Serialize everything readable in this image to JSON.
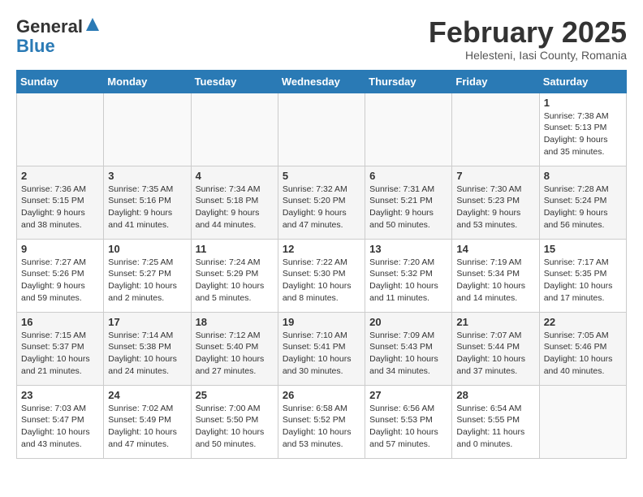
{
  "header": {
    "logo_general": "General",
    "logo_blue": "Blue",
    "title": "February 2025",
    "subtitle": "Helesteni, Iasi County, Romania"
  },
  "days_of_week": [
    "Sunday",
    "Monday",
    "Tuesday",
    "Wednesday",
    "Thursday",
    "Friday",
    "Saturday"
  ],
  "weeks": [
    [
      {
        "day": "",
        "info": ""
      },
      {
        "day": "",
        "info": ""
      },
      {
        "day": "",
        "info": ""
      },
      {
        "day": "",
        "info": ""
      },
      {
        "day": "",
        "info": ""
      },
      {
        "day": "",
        "info": ""
      },
      {
        "day": "1",
        "info": "Sunrise: 7:38 AM\nSunset: 5:13 PM\nDaylight: 9 hours and 35 minutes."
      }
    ],
    [
      {
        "day": "2",
        "info": "Sunrise: 7:36 AM\nSunset: 5:15 PM\nDaylight: 9 hours and 38 minutes."
      },
      {
        "day": "3",
        "info": "Sunrise: 7:35 AM\nSunset: 5:16 PM\nDaylight: 9 hours and 41 minutes."
      },
      {
        "day": "4",
        "info": "Sunrise: 7:34 AM\nSunset: 5:18 PM\nDaylight: 9 hours and 44 minutes."
      },
      {
        "day": "5",
        "info": "Sunrise: 7:32 AM\nSunset: 5:20 PM\nDaylight: 9 hours and 47 minutes."
      },
      {
        "day": "6",
        "info": "Sunrise: 7:31 AM\nSunset: 5:21 PM\nDaylight: 9 hours and 50 minutes."
      },
      {
        "day": "7",
        "info": "Sunrise: 7:30 AM\nSunset: 5:23 PM\nDaylight: 9 hours and 53 minutes."
      },
      {
        "day": "8",
        "info": "Sunrise: 7:28 AM\nSunset: 5:24 PM\nDaylight: 9 hours and 56 minutes."
      }
    ],
    [
      {
        "day": "9",
        "info": "Sunrise: 7:27 AM\nSunset: 5:26 PM\nDaylight: 9 hours and 59 minutes."
      },
      {
        "day": "10",
        "info": "Sunrise: 7:25 AM\nSunset: 5:27 PM\nDaylight: 10 hours and 2 minutes."
      },
      {
        "day": "11",
        "info": "Sunrise: 7:24 AM\nSunset: 5:29 PM\nDaylight: 10 hours and 5 minutes."
      },
      {
        "day": "12",
        "info": "Sunrise: 7:22 AM\nSunset: 5:30 PM\nDaylight: 10 hours and 8 minutes."
      },
      {
        "day": "13",
        "info": "Sunrise: 7:20 AM\nSunset: 5:32 PM\nDaylight: 10 hours and 11 minutes."
      },
      {
        "day": "14",
        "info": "Sunrise: 7:19 AM\nSunset: 5:34 PM\nDaylight: 10 hours and 14 minutes."
      },
      {
        "day": "15",
        "info": "Sunrise: 7:17 AM\nSunset: 5:35 PM\nDaylight: 10 hours and 17 minutes."
      }
    ],
    [
      {
        "day": "16",
        "info": "Sunrise: 7:15 AM\nSunset: 5:37 PM\nDaylight: 10 hours and 21 minutes."
      },
      {
        "day": "17",
        "info": "Sunrise: 7:14 AM\nSunset: 5:38 PM\nDaylight: 10 hours and 24 minutes."
      },
      {
        "day": "18",
        "info": "Sunrise: 7:12 AM\nSunset: 5:40 PM\nDaylight: 10 hours and 27 minutes."
      },
      {
        "day": "19",
        "info": "Sunrise: 7:10 AM\nSunset: 5:41 PM\nDaylight: 10 hours and 30 minutes."
      },
      {
        "day": "20",
        "info": "Sunrise: 7:09 AM\nSunset: 5:43 PM\nDaylight: 10 hours and 34 minutes."
      },
      {
        "day": "21",
        "info": "Sunrise: 7:07 AM\nSunset: 5:44 PM\nDaylight: 10 hours and 37 minutes."
      },
      {
        "day": "22",
        "info": "Sunrise: 7:05 AM\nSunset: 5:46 PM\nDaylight: 10 hours and 40 minutes."
      }
    ],
    [
      {
        "day": "23",
        "info": "Sunrise: 7:03 AM\nSunset: 5:47 PM\nDaylight: 10 hours and 43 minutes."
      },
      {
        "day": "24",
        "info": "Sunrise: 7:02 AM\nSunset: 5:49 PM\nDaylight: 10 hours and 47 minutes."
      },
      {
        "day": "25",
        "info": "Sunrise: 7:00 AM\nSunset: 5:50 PM\nDaylight: 10 hours and 50 minutes."
      },
      {
        "day": "26",
        "info": "Sunrise: 6:58 AM\nSunset: 5:52 PM\nDaylight: 10 hours and 53 minutes."
      },
      {
        "day": "27",
        "info": "Sunrise: 6:56 AM\nSunset: 5:53 PM\nDaylight: 10 hours and 57 minutes."
      },
      {
        "day": "28",
        "info": "Sunrise: 6:54 AM\nSunset: 5:55 PM\nDaylight: 11 hours and 0 minutes."
      },
      {
        "day": "",
        "info": ""
      }
    ]
  ]
}
